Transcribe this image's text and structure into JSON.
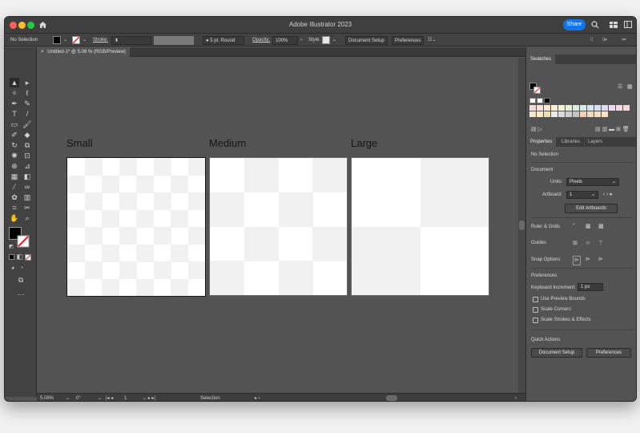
{
  "window": {
    "title": "Adobe Illustrator 2023",
    "share_label": "Share",
    "traffic_colors": [
      "#ff5f57",
      "#febc2e",
      "#28c840"
    ]
  },
  "control_bar": {
    "selection_label": "No Selection",
    "stroke_label": "Stroke:",
    "brush_label": "5 pt. Round",
    "opacity_label": "Opacity:",
    "opacity_value": "100%",
    "style_label": "Style:",
    "document_setup_label": "Document Setup",
    "preferences_label": "Preferences"
  },
  "document": {
    "tab_label": "Untitled-1* @ 5.08 % (RGB/Preview)",
    "close_symbol": "×"
  },
  "artboards": [
    {
      "label": "Small",
      "grid": 8
    },
    {
      "label": "Medium",
      "grid": 4
    },
    {
      "label": "Large",
      "grid": 2
    }
  ],
  "statusbar": {
    "zoom": "5.08%",
    "rotation": "0°",
    "artboard_number": "1",
    "tool": "Selection"
  },
  "swatches_panel": {
    "title": "Swatches",
    "colors": [
      "#f6dada",
      "#f8e0d4",
      "#fbe8d0",
      "#f9eed2",
      "#f5f3d2",
      "#e6f1d8",
      "#daeedc",
      "#d7ebe9",
      "#d4e6f2",
      "#d8dff3",
      "#e1dbf1",
      "#ecdaee",
      "#f3d9e6",
      "#f6d8d8",
      "#f8e6c8",
      "#fbecc4",
      "#f3e0ad",
      "#e9e9e9",
      "#dcdcdc",
      "#cfcfcf",
      "#c3c3c3",
      "#f1d1b0",
      "#f4d9b8",
      "#f7e0c0",
      "#f9e4c4"
    ]
  },
  "properties_panel": {
    "tabs": [
      "Properties",
      "Libraries",
      "Layers"
    ],
    "no_selection": "No Selection",
    "document_header": "Document",
    "units_label": "Units:",
    "units_value": "Pixels",
    "artboard_label": "Artboard:",
    "artboard_value": "1",
    "edit_artboards_label": "Edit Artboards",
    "ruler_grids_label": "Ruler & Grids",
    "guides_label": "Guides",
    "snap_options_label": "Snap Options",
    "preferences_header": "Preferences",
    "keyboard_increment_label": "Keyboard Increment:",
    "keyboard_increment_value": "1 px",
    "checkbox_preview_bounds": "Use Preview Bounds",
    "checkbox_scale_corners": "Scale Corners",
    "checkbox_scale_strokes": "Scale Strokes & Effects",
    "quick_actions_header": "Quick Actions",
    "document_setup_label": "Document Setup",
    "preferences_label": "Preferences"
  }
}
